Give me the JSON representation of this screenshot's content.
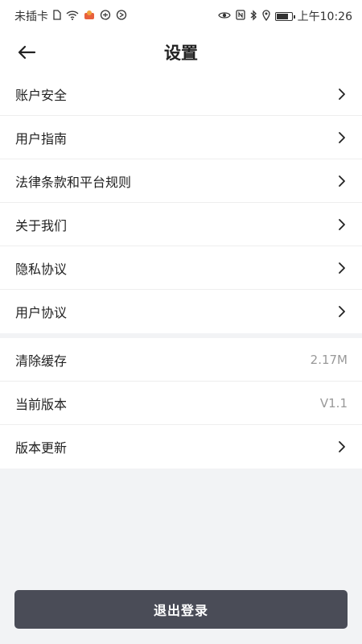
{
  "status_bar": {
    "carrier": "未插卡",
    "time": "上午10:26",
    "icons_left": [
      "sim-card-icon",
      "wifi-icon",
      "notification-app-icon",
      "gamepad-icon",
      "vpn-icon"
    ],
    "icons_right": [
      "eye-icon",
      "nfc-icon",
      "bluetooth-icon",
      "location-icon",
      "battery-icon"
    ]
  },
  "header": {
    "title": "设置",
    "back_icon": "back-arrow-icon"
  },
  "group1": {
    "items": [
      {
        "label": "账户安全"
      },
      {
        "label": "用户指南"
      },
      {
        "label": "法律条款和平台规则"
      },
      {
        "label": "关于我们"
      },
      {
        "label": "隐私协议"
      },
      {
        "label": "用户协议"
      }
    ]
  },
  "group2": {
    "clear_cache": {
      "label": "清除缓存",
      "value": "2.17M"
    },
    "current_version": {
      "label": "当前版本",
      "value": "V1.1"
    },
    "update_version": {
      "label": "版本更新"
    }
  },
  "logout": {
    "label": "退出登录"
  },
  "colors": {
    "background": "#f2f3f5",
    "button": "#4a4c57",
    "text": "#222222",
    "muted": "#999999"
  }
}
